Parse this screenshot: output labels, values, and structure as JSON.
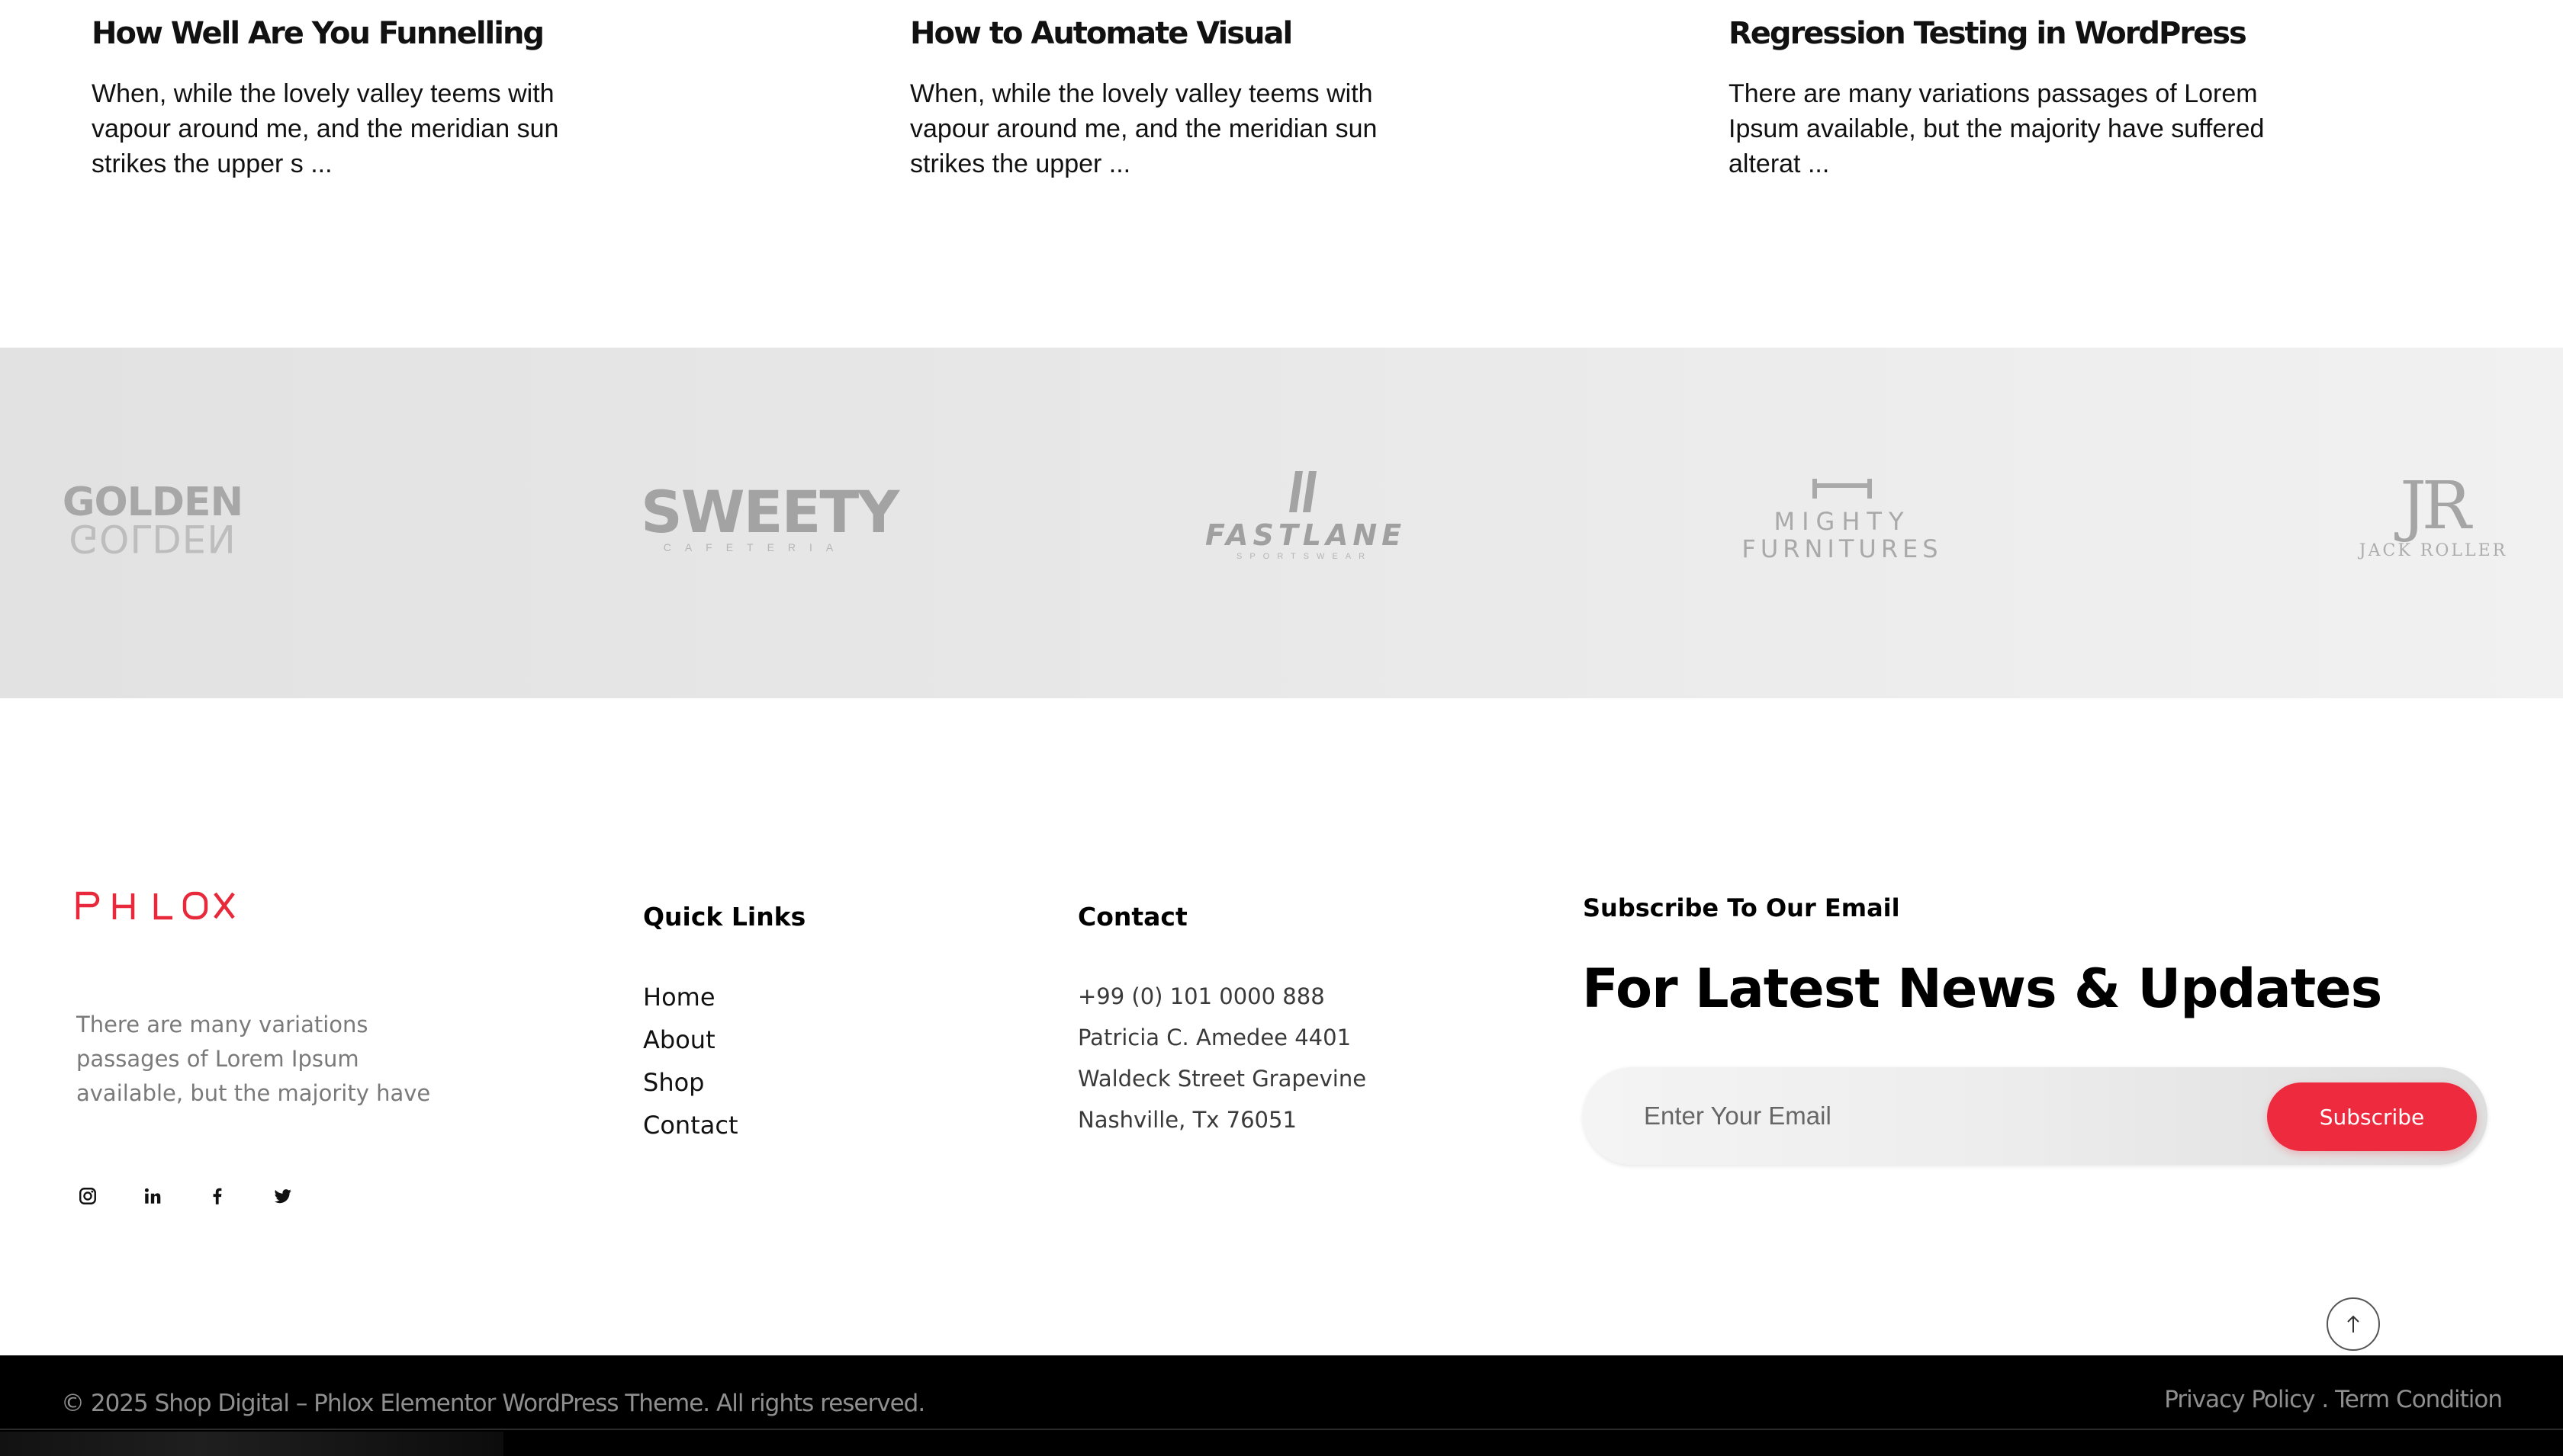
{
  "posts": [
    {
      "title": "How Well Are You Funnelling",
      "excerpt": "When, while the lovely valley teems with vapour around me, and the meridian sun strikes the upper s ..."
    },
    {
      "title": "How to Automate Visual",
      "excerpt": "When, while the lovely valley teems with vapour around me, and the meridian sun strikes the upper ..."
    },
    {
      "title": "Regression Testing in WordPress",
      "excerpt": "There are many variations passages of Lorem Ipsum available, but the majority have suffered alterat ..."
    }
  ],
  "brands": {
    "golden": {
      "main": "GOLDEN",
      "mirror": "GOLDEN"
    },
    "sweety": {
      "main": "SWEETY",
      "sub": "CAFETERIA"
    },
    "fastlane": {
      "main": "FASTLANE",
      "sub": "SPORTSWEAR"
    },
    "mighty": {
      "line1": "MIGHTY",
      "line2": "FURNITURES"
    },
    "jack": {
      "main": "JR",
      "sub": "JACK ROLLER"
    }
  },
  "footer": {
    "logo_text": "PHLOX",
    "about": "There are many variations passages of Lorem Ipsum available, but the majority have",
    "social": [
      "instagram-icon",
      "linkedin-icon",
      "facebook-icon",
      "twitter-icon"
    ],
    "quick_links": {
      "title": "Quick Links",
      "items": [
        "Home",
        "About",
        "Shop",
        "Contact"
      ]
    },
    "contact": {
      "title": "Contact",
      "lines": [
        "+99 (0) 101 0000 888",
        "Patricia C. Amedee 4401",
        "Waldeck Street Grapevine",
        "Nashville, Tx 76051"
      ]
    },
    "subscribe": {
      "title": "Subscribe To Our Email",
      "headline": "For Latest News & Updates",
      "placeholder": "Enter Your Email",
      "button": "Subscribe"
    }
  },
  "bottom_bar": {
    "copyright": "© 2025 Shop Digital – Phlox Elementor WordPress Theme. All rights reserved.",
    "privacy": "Privacy Policy",
    "separator": " . ",
    "terms": "Term Condition"
  },
  "colors": {
    "accent": "#ee2b3e",
    "logo": "#e8293c",
    "bottom_bar": "#000000",
    "brand_strip": "#e6e6e6"
  }
}
